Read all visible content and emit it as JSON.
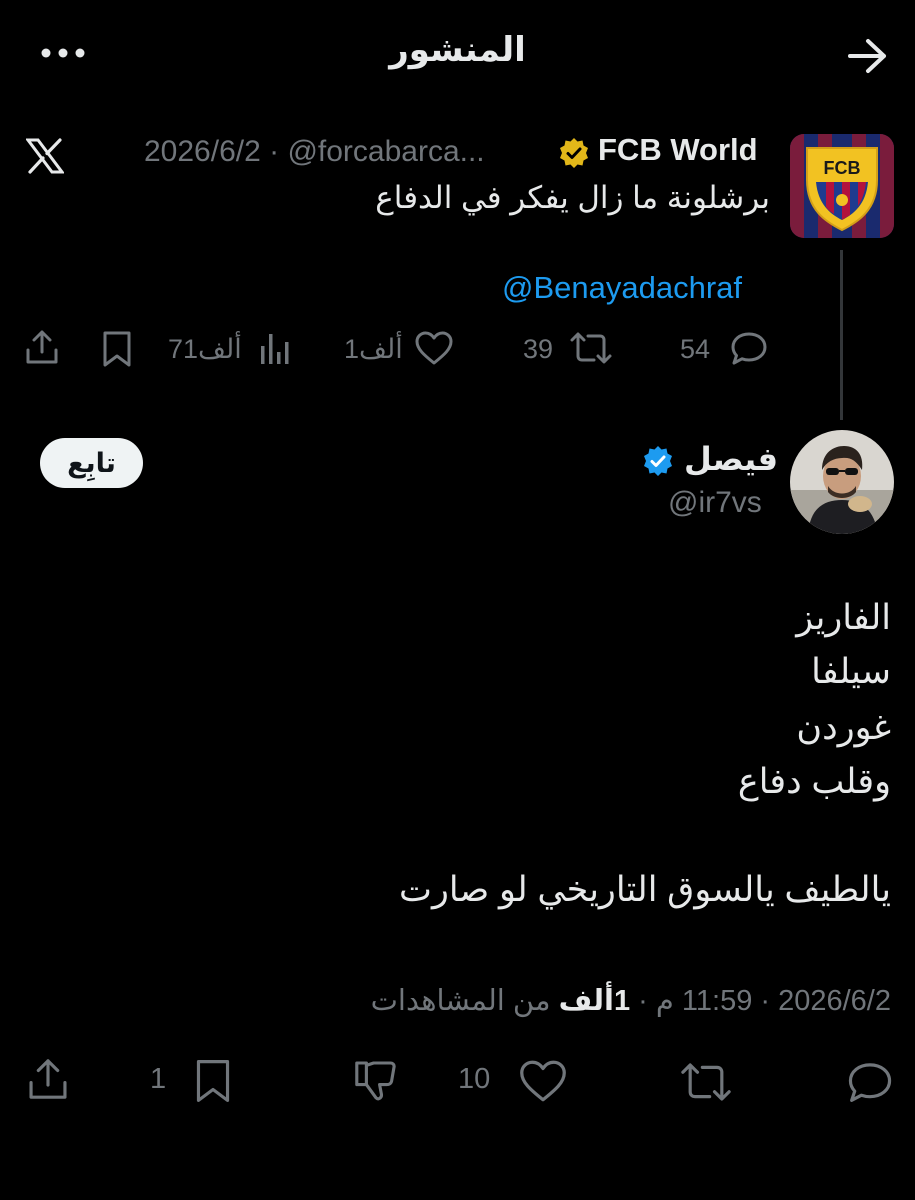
{
  "header": {
    "title": "المنشور",
    "back_icon": "arrow-right-icon",
    "more_icon": "more-horizontal-icon"
  },
  "quoted_tweet": {
    "avatar_text": "FCB",
    "author_name": "FCB World",
    "verified_badge": "gold-verified-badge-icon",
    "meta": "2026/6/2 · @forcabarca...",
    "source_icon": "x-logo-icon",
    "text": "برشلونة ما زال يفكر في الدفاع",
    "mention": "@Benayadachraf",
    "actions": {
      "replies": "54",
      "reposts": "39",
      "likes": "1ألف",
      "views": "71ألف"
    }
  },
  "main_tweet": {
    "author_name": "فيصل",
    "verified_badge": "blue-verified-badge-icon",
    "handle": "@ir7vs",
    "follow_label": "تابِع",
    "lines": [
      "الفاريز",
      "سيلفا",
      "غوردن",
      "وقلب دفاع",
      "يالطيف يالسوق التاريخي لو صارت"
    ],
    "meta": {
      "date": "2026/6/2",
      "time": "11:59 م",
      "views_value": "1ألف",
      "views_suffix": "من المشاهدات"
    },
    "actions": {
      "likes": "10",
      "bookmarks": "1"
    }
  },
  "colors": {
    "background": "#000000",
    "text": "#e7e9ea",
    "muted": "#71767b",
    "link": "#1d9bf0",
    "verified_blue": "#1d9bf0",
    "verified_gold": "#e2b719"
  }
}
